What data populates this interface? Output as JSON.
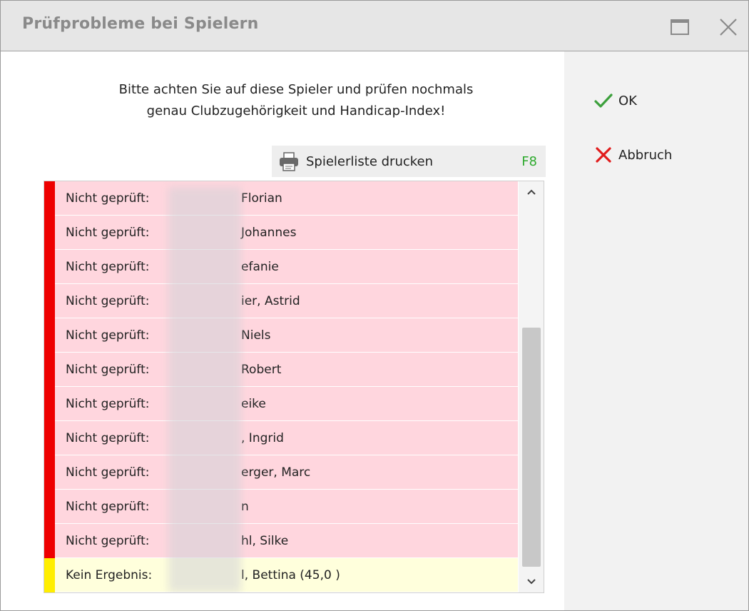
{
  "window": {
    "title": "Prüfprobleme bei Spielern"
  },
  "message": {
    "line1": "Bitte achten Sie auf diese Spieler und prüfen nochmals",
    "line2": "genau Clubzugehörigkeit und Handicap-Index!"
  },
  "actions": {
    "ok_label": "OK",
    "cancel_label": "Abbruch"
  },
  "print": {
    "label": "Spielerliste drucken",
    "shortcut": "F8"
  },
  "colors": {
    "error_mark": "#ee0000",
    "error_bg": "#ffd6de",
    "warning_mark": "#ffee00",
    "warning_bg": "#ffffdc",
    "ok_icon": "#3ca03c",
    "cancel_icon": "#e11c1c",
    "shortcut": "#2eaa2e"
  },
  "players": [
    {
      "status": "Nicht geprüft:",
      "name": "Florian",
      "severity": "error"
    },
    {
      "status": "Nicht geprüft:",
      "name": "Johannes",
      "severity": "error"
    },
    {
      "status": "Nicht geprüft:",
      "name": "efanie",
      "severity": "error"
    },
    {
      "status": "Nicht geprüft:",
      "name": "ier, Astrid",
      "severity": "error"
    },
    {
      "status": "Nicht geprüft:",
      "name": "Niels",
      "severity": "error"
    },
    {
      "status": "Nicht geprüft:",
      "name": "Robert",
      "severity": "error"
    },
    {
      "status": "Nicht geprüft:",
      "name": "eike",
      "severity": "error"
    },
    {
      "status": "Nicht geprüft:",
      "name": ", Ingrid",
      "severity": "error"
    },
    {
      "status": "Nicht geprüft:",
      "name": "erger, Marc",
      "severity": "error"
    },
    {
      "status": "Nicht geprüft:",
      "name": "n",
      "severity": "error"
    },
    {
      "status": "Nicht geprüft:",
      "name": "hl, Silke",
      "severity": "error"
    },
    {
      "status": "Kein Ergebnis:",
      "name": "l, Bettina (45,0 )",
      "severity": "warning"
    }
  ],
  "icons": {
    "maximize": "maximize-icon",
    "close": "close-icon",
    "ok": "checkmark-icon",
    "cancel": "x-icon",
    "print": "printer-icon",
    "scroll_up": "chevron-up-icon",
    "scroll_down": "chevron-down-icon"
  }
}
